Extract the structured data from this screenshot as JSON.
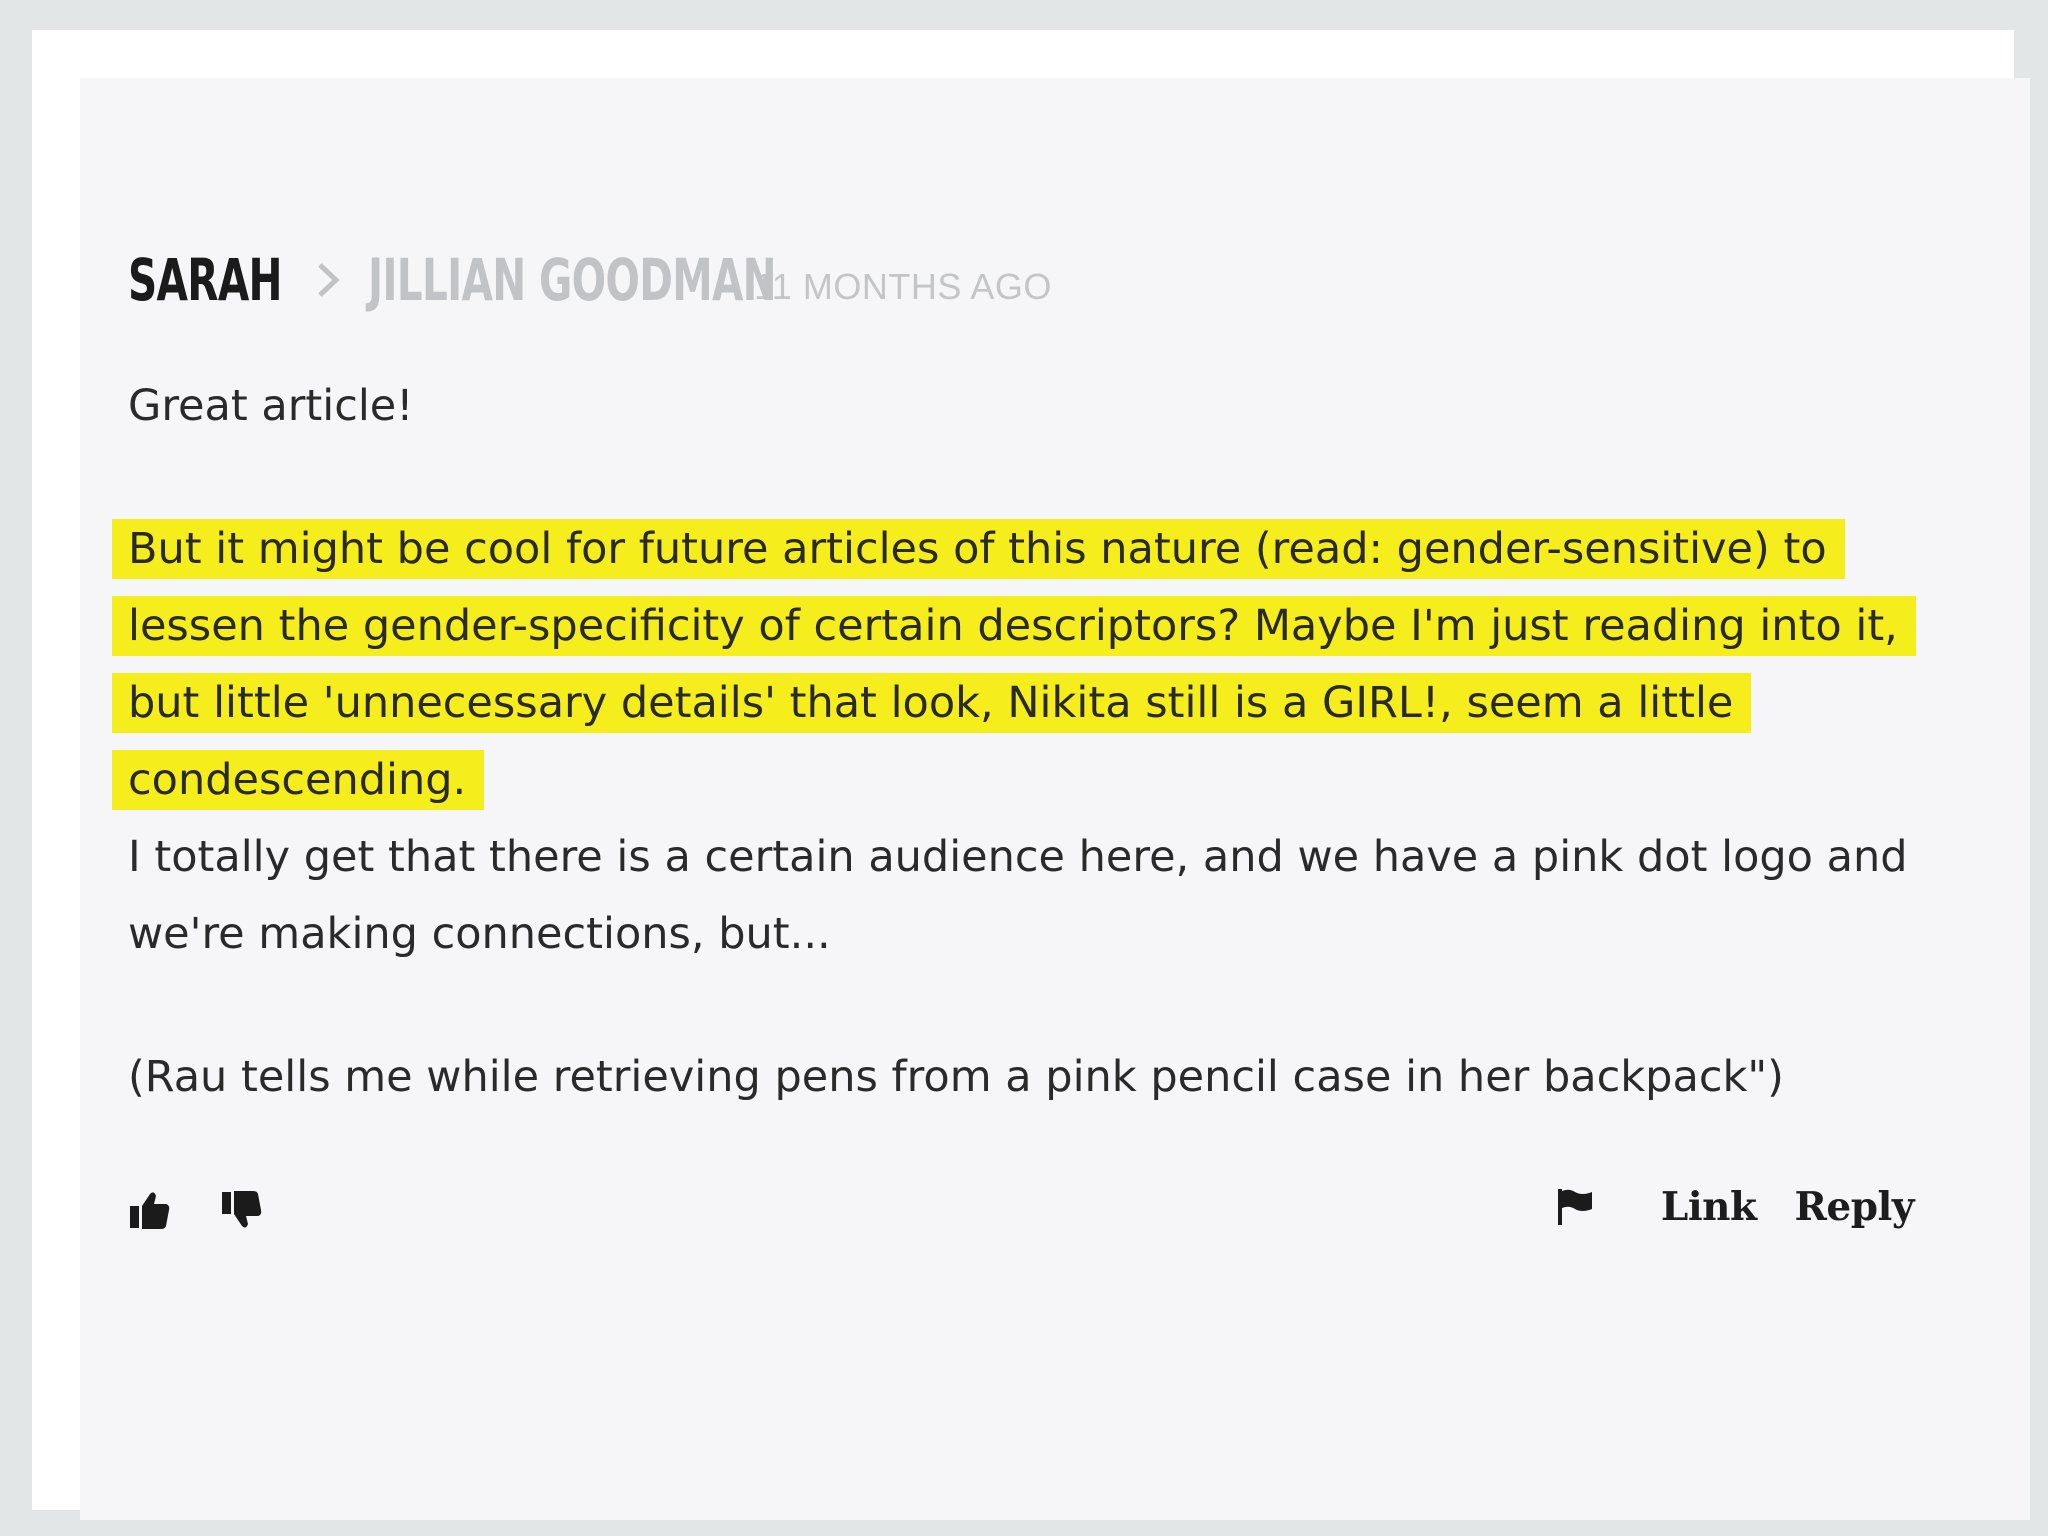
{
  "comment": {
    "author": "SARAH",
    "recipient": "JILLIAN GOODMAN",
    "timestamp": "11 MONTHS AGO",
    "opening": "Great article!",
    "highlighted_lines": [
      "But it might be cool for future articles of this nature (read: gender-sensitive) to",
      "lessen the gender-specificity of certain descriptors? Maybe I'm just reading into it,",
      "but little 'unnecessary details' that look, Nikita still is a GIRL!, seem a little",
      "condescending."
    ],
    "paragraph_2_lines": [
      "I totally get that there is a certain audience here, and we have a pink dot logo and",
      "we're making connections, but..."
    ],
    "quote": "(Rau tells me while retrieving pens from a pink pencil case in her backpack\")"
  },
  "actions": {
    "upvote_icon": "thumbs-up-icon",
    "downvote_icon": "thumbs-down-icon",
    "flag_icon": "flag-icon",
    "link_label": "Link",
    "reply_label": "Reply"
  },
  "colors": {
    "highlight": "#f5ee1c",
    "author": "#1b1b1b",
    "muted": "#c2c3c7",
    "card_background": "#f6f6f8",
    "outer_background": "#e3e6e7"
  }
}
